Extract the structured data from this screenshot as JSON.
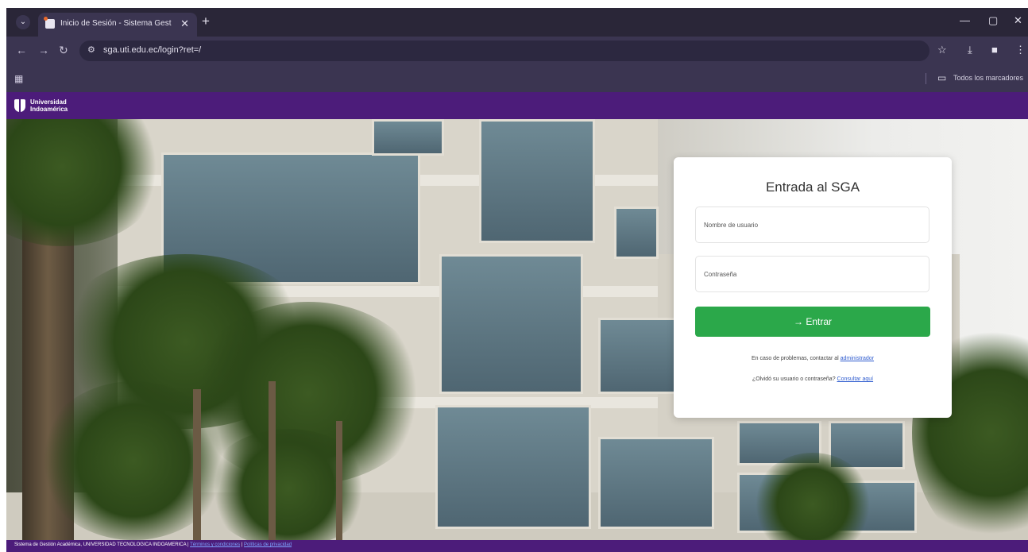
{
  "browser": {
    "tab_title": "Inicio de Sesión - Sistema Gest",
    "new_tab": "+",
    "url": "sga.uti.edu.ec/login?ret=/",
    "bookmark_folder": "Todos los marcadores"
  },
  "brand": {
    "line1": "Universidad",
    "line2": "Indoamérica"
  },
  "login": {
    "title": "Entrada al SGA",
    "username_placeholder": "Nombre de usuario",
    "password_placeholder": "Contraseña",
    "submit_label": "→ Entrar",
    "problems_text": "En caso de problemas, contactar al",
    "problems_link": "administrador",
    "forgot_text": "¿Olvidó su usuario o contraseña?",
    "forgot_link": "Consultar aquí"
  },
  "footer": {
    "text": "Sistema de Gestión Académica, UNIVERSIDAD TECNOLOGICA INDOAMERICA |",
    "link1": "Términos y condiciones",
    "sep": "|",
    "link2": "Políticas de privacidad"
  },
  "colors": {
    "brand_purple": "#4c1c7a",
    "button_green": "#2ba84a",
    "link_blue": "#2f5ccf"
  }
}
